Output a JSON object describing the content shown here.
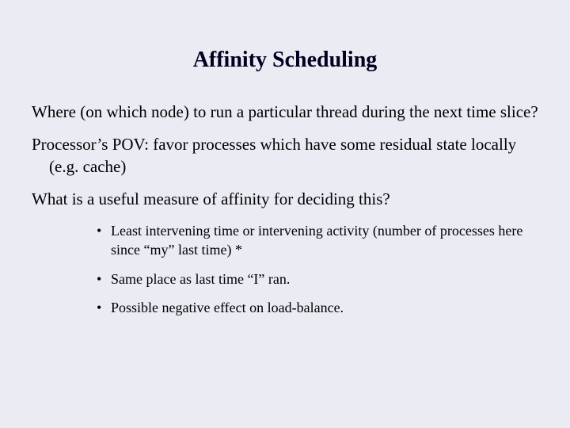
{
  "title": "Affinity Scheduling",
  "paragraphs": {
    "p1": "Where (on which node) to run a particular thread during the next time slice?",
    "p2": "Processor’s POV: favor processes which have some residual state locally (e.g. cache)",
    "p3": "What is a useful measure of affinity for deciding this?"
  },
  "bullets": {
    "b1": "Least intervening time or intervening activity (number of processes here since “my” last time)  *",
    "b2": "Same place as last time “I” ran.",
    "b3": "Possible negative effect on load-balance."
  }
}
